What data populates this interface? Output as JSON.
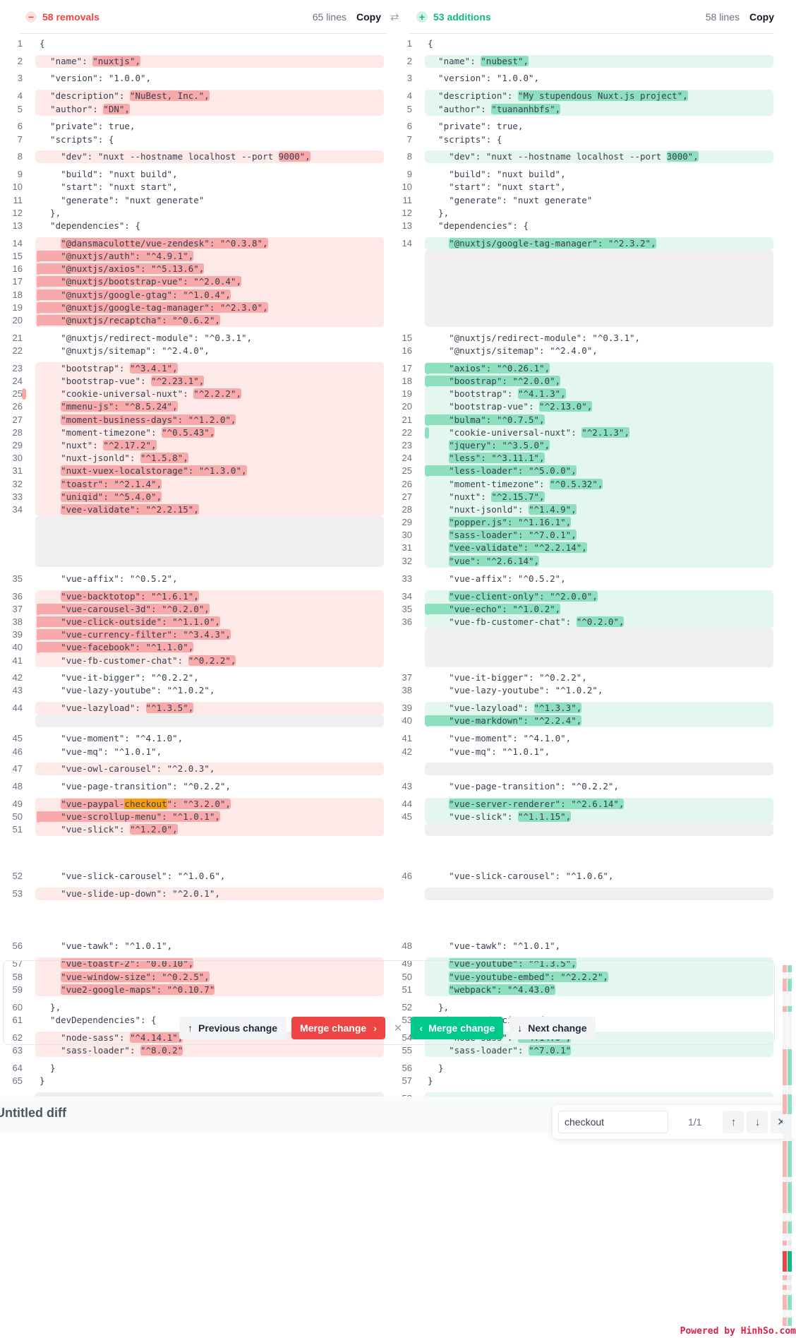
{
  "left": {
    "badge_icon": "minus-icon",
    "count_label": "58 removals",
    "lines_label": "65 lines",
    "copy_label": "Copy"
  },
  "right": {
    "badge_icon": "plus-icon",
    "count_label": "53 additions",
    "lines_label": "58 lines",
    "copy_label": "Copy"
  },
  "swap_icon": "swap-arrows-icon",
  "colors": {
    "removal": "#ef4444",
    "addition": "#10b981",
    "removal_bg": "#fee9e9",
    "addition_bg": "#e3f7ef",
    "removal_highlight": "#f8a9a9",
    "addition_highlight": "#8ddfc0",
    "search_match": "#f59e0b"
  },
  "left_lines": [
    {
      "n": "1",
      "t": "{"
    },
    {
      "n": "2",
      "t": "  \"name\": \"nuxtjs\","
    },
    {
      "n": "3",
      "t": "  \"version\": \"1.0.0\","
    },
    {
      "n": "4",
      "t": "  \"description\": \"NuBest, Inc.\","
    },
    {
      "n": "5",
      "t": "  \"author\": \"DN\","
    },
    {
      "n": "6",
      "t": "  \"private\": true,"
    },
    {
      "n": "7",
      "t": "  \"scripts\": {"
    },
    {
      "n": "8",
      "t": "    \"dev\": \"nuxt --hostname localhost --port 9000\","
    },
    {
      "n": "9",
      "t": "    \"build\": \"nuxt build\","
    },
    {
      "n": "10",
      "t": "    \"start\": \"nuxt start\","
    },
    {
      "n": "11",
      "t": "    \"generate\": \"nuxt generate\""
    },
    {
      "n": "12",
      "t": "  },"
    },
    {
      "n": "13",
      "t": "  \"dependencies\": {"
    },
    {
      "n": "14",
      "t": "    \"@dansmaculotte/vue-zendesk\": \"^0.3.8\","
    },
    {
      "n": "15",
      "t": "    \"@nuxtjs/auth\": \"^4.9.1\","
    },
    {
      "n": "16",
      "t": "    \"@nuxtjs/axios\": \"^5.13.6\","
    },
    {
      "n": "17",
      "t": "    \"@nuxtjs/bootstrap-vue\": \"^2.0.4\","
    },
    {
      "n": "18",
      "t": "    \"@nuxtjs/google-gtag\": \"^1.0.4\","
    },
    {
      "n": "19",
      "t": "    \"@nuxtjs/google-tag-manager\": \"^2.3.0\","
    },
    {
      "n": "20",
      "t": "    \"@nuxtjs/recaptcha\": \"^0.6.2\","
    },
    {
      "n": "21",
      "t": "    \"@nuxtjs/redirect-module\": \"^0.3.1\","
    },
    {
      "n": "22",
      "t": "    \"@nuxtjs/sitemap\": \"^2.4.0\","
    },
    {
      "n": "23",
      "t": "    \"bootstrap\": \"^3.4.1\","
    },
    {
      "n": "24",
      "t": "    \"bootstrap-vue\": \"^2.23.1\","
    },
    {
      "n": "25",
      "t": "    \"cookie-universal-nuxt\": \"^2.2.2\","
    },
    {
      "n": "26",
      "t": "    \"mmenu-js\": \"^8.5.24\","
    },
    {
      "n": "27",
      "t": "    \"moment-business-days\": \"^1.2.0\","
    },
    {
      "n": "28",
      "t": "    \"moment-timezone\": \"^0.5.43\","
    },
    {
      "n": "29",
      "t": "    \"nuxt\": \"^2.17.2\","
    },
    {
      "n": "30",
      "t": "    \"nuxt-jsonld\": \"^1.5.8\","
    },
    {
      "n": "31",
      "t": "    \"nuxt-vuex-localstorage\": \"^1.3.0\","
    },
    {
      "n": "32",
      "t": "    \"toastr\": \"^2.1.4\","
    },
    {
      "n": "33",
      "t": "    \"uniqid\": \"^5.4.0\","
    },
    {
      "n": "34",
      "t": "    \"vee-validate\": \"^2.2.15\","
    },
    {
      "n": "35",
      "t": "    \"vue-affix\": \"^0.5.2\","
    },
    {
      "n": "36",
      "t": "    \"vue-backtotop\": \"^1.6.1\","
    },
    {
      "n": "37",
      "t": "    \"vue-carousel-3d\": \"^0.2.0\","
    },
    {
      "n": "38",
      "t": "    \"vue-click-outside\": \"^1.1.0\","
    },
    {
      "n": "39",
      "t": "    \"vue-currency-filter\": \"^3.4.3\","
    },
    {
      "n": "40",
      "t": "    \"vue-facebook\": \"^1.1.0\","
    },
    {
      "n": "41",
      "t": "    \"vue-fb-customer-chat\": \"^0.2.2\","
    },
    {
      "n": "42",
      "t": "    \"vue-it-bigger\": \"^0.2.2\","
    },
    {
      "n": "43",
      "t": "    \"vue-lazy-youtube\": \"^1.0.2\","
    },
    {
      "n": "44",
      "t": "    \"vue-lazyload\": \"^1.3.5\","
    },
    {
      "n": "45",
      "t": "    \"vue-moment\": \"^4.1.0\","
    },
    {
      "n": "46",
      "t": "    \"vue-mq\": \"^1.0.1\","
    },
    {
      "n": "47",
      "t": "    \"vue-owl-carousel\": \"^2.0.3\","
    },
    {
      "n": "48",
      "t": "    \"vue-page-transition\": \"^0.2.2\","
    },
    {
      "n": "49",
      "t": "    \"vue-paypal-checkout\": \"^3.2.0\","
    },
    {
      "n": "50",
      "t": "    \"vue-scrollup-menu\": \"^1.0.1\","
    },
    {
      "n": "51",
      "t": "    \"vue-slick\": \"^1.2.0\","
    },
    {
      "n": "52",
      "t": "    \"vue-slick-carousel\": \"^1.0.6\","
    },
    {
      "n": "53",
      "t": "    \"vue-slide-up-down\": \"^2.0.1\","
    },
    {
      "n": "56",
      "t": "    \"vue-tawk\": \"^1.0.1\","
    },
    {
      "n": "57",
      "t": "    \"vue-toastr-2\": \"0.0.10\","
    },
    {
      "n": "58",
      "t": "    \"vue-window-size\": \"^0.2.5\","
    },
    {
      "n": "59",
      "t": "    \"vue2-google-maps\": \"^0.10.7\""
    },
    {
      "n": "60",
      "t": "  },"
    },
    {
      "n": "61",
      "t": "  \"devDependencies\": {"
    },
    {
      "n": "62",
      "t": "    \"node-sass\": \"^4.14.1\","
    },
    {
      "n": "63",
      "t": "    \"sass-loader\": \"^8.0.2\""
    },
    {
      "n": "64",
      "t": "  }"
    },
    {
      "n": "65",
      "t": "}"
    }
  ],
  "right_lines": [
    {
      "n": "1",
      "t": "{"
    },
    {
      "n": "2",
      "t": "  \"name\": \"nubest\","
    },
    {
      "n": "3",
      "t": "  \"version\": \"1.0.0\","
    },
    {
      "n": "4",
      "t": "  \"description\": \"My stupendous Nuxt.js project\","
    },
    {
      "n": "5",
      "t": "  \"author\": \"tuananhbfs\","
    },
    {
      "n": "6",
      "t": "  \"private\": true,"
    },
    {
      "n": "7",
      "t": "  \"scripts\": {"
    },
    {
      "n": "8",
      "t": "    \"dev\": \"nuxt --hostname localhost --port 3000\","
    },
    {
      "n": "9",
      "t": "    \"build\": \"nuxt build\","
    },
    {
      "n": "10",
      "t": "    \"start\": \"nuxt start\","
    },
    {
      "n": "11",
      "t": "    \"generate\": \"nuxt generate\""
    },
    {
      "n": "12",
      "t": "  },"
    },
    {
      "n": "13",
      "t": "  \"dependencies\": {"
    },
    {
      "n": "14",
      "t": "    \"@nuxtjs/google-tag-manager\": \"^2.3.2\","
    },
    {
      "n": "15",
      "t": "    \"@nuxtjs/redirect-module\": \"^0.3.1\","
    },
    {
      "n": "16",
      "t": "    \"@nuxtjs/sitemap\": \"^2.4.0\","
    },
    {
      "n": "17",
      "t": "    \"axios\": \"^0.26.1\","
    },
    {
      "n": "18",
      "t": "    \"boostrap\": \"^2.0.0\","
    },
    {
      "n": "19",
      "t": "    \"bootstrap\": \"^4.1.3\","
    },
    {
      "n": "20",
      "t": "    \"bootstrap-vue\": \"^2.13.0\","
    },
    {
      "n": "21",
      "t": "    \"bulma\": \"^0.7.5\","
    },
    {
      "n": "22",
      "t": "    \"cookie-universal-nuxt\": \"^2.1.3\","
    },
    {
      "n": "23",
      "t": "    \"jquery\": \"^3.5.0\","
    },
    {
      "n": "24",
      "t": "    \"less\": \"^3.11.1\","
    },
    {
      "n": "25",
      "t": "    \"less-loader\": \"^5.0.0\","
    },
    {
      "n": "26",
      "t": "    \"moment-timezone\": \"^0.5.32\","
    },
    {
      "n": "27",
      "t": "    \"nuxt\": \"^2.15.7\","
    },
    {
      "n": "28",
      "t": "    \"nuxt-jsonld\": \"^1.4.9\","
    },
    {
      "n": "29",
      "t": "    \"popper.js\": \"^1.16.1\","
    },
    {
      "n": "30",
      "t": "    \"sass-loader\": \"^7.0.1\","
    },
    {
      "n": "31",
      "t": "    \"vee-validate\": \"^2.2.14\","
    },
    {
      "n": "32",
      "t": "    \"vue\": \"^2.6.14\","
    },
    {
      "n": "33",
      "t": "    \"vue-affix\": \"^0.5.2\","
    },
    {
      "n": "34",
      "t": "    \"vue-client-only\": \"^2.0.0\","
    },
    {
      "n": "35",
      "t": "    \"vue-echo\": \"^1.0.2\","
    },
    {
      "n": "36",
      "t": "    \"vue-fb-customer-chat\": \"^0.2.0\","
    },
    {
      "n": "37",
      "t": "    \"vue-it-bigger\": \"^0.2.2\","
    },
    {
      "n": "38",
      "t": "    \"vue-lazy-youtube\": \"^1.0.2\","
    },
    {
      "n": "39",
      "t": "    \"vue-lazyload\": \"^1.3.3\","
    },
    {
      "n": "40",
      "t": "    \"vue-markdown\": \"^2.2.4\","
    },
    {
      "n": "41",
      "t": "    \"vue-moment\": \"^4.1.0\","
    },
    {
      "n": "42",
      "t": "    \"vue-mq\": \"^1.0.1\","
    },
    {
      "n": "43",
      "t": "    \"vue-page-transition\": \"^0.2.2\","
    },
    {
      "n": "44",
      "t": "    \"vue-server-renderer\": \"^2.6.14\","
    },
    {
      "n": "45",
      "t": "    \"vue-slick\": \"^1.1.15\","
    },
    {
      "n": "46",
      "t": "    \"vue-slick-carousel\": \"^1.0.6\","
    },
    {
      "n": "48",
      "t": "    \"vue-tawk\": \"^1.0.1\","
    },
    {
      "n": "49",
      "t": "    \"vue-youtube\": \"^1.3.5\","
    },
    {
      "n": "50",
      "t": "    \"vue-youtube-embed\": \"^2.2.2\","
    },
    {
      "n": "51",
      "t": "    \"webpack\": \"^4.43.0\""
    },
    {
      "n": "52",
      "t": "  },"
    },
    {
      "n": "53",
      "t": "  \"devDependencies\": {"
    },
    {
      "n": "54",
      "t": "    \"node-sass\": \"^4.14.0\","
    },
    {
      "n": "55",
      "t": "    \"sass-loader\": \"^7.0.1\""
    },
    {
      "n": "56",
      "t": "  }"
    },
    {
      "n": "57",
      "t": "}"
    },
    {
      "n": "58",
      "t": ""
    }
  ],
  "change_actions": {
    "previous_label": "Previous change",
    "previous_icon": "arrow-up-icon",
    "merge_left_label": "Merge change",
    "merge_left_icon": "chevron-right-icon",
    "dismiss_icon": "close-icon",
    "merge_right_label": "Merge change",
    "merge_right_icon": "chevron-left-icon",
    "next_label": "Next change",
    "next_icon": "arrow-down-icon"
  },
  "section_title": "Untitled diff",
  "search": {
    "value": "checkout",
    "match_count": "1/1",
    "prev_icon": "arrow-up-icon",
    "next_icon": "arrow-down-icon",
    "close_icon": "close-icon"
  },
  "watermark": "Powered by HinhSo.com"
}
